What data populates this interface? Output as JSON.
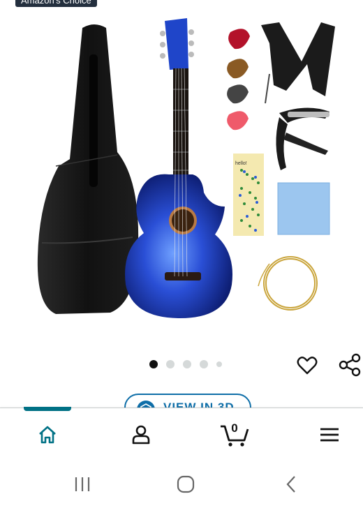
{
  "badge": {
    "label": "Amazon's Choice"
  },
  "product": {
    "image_icon": "guitar-kit-image",
    "image_alt": "Blue acoustic guitar kit with gig bag, picks, strap, capo, fretboard stickers, cloth and strings",
    "fretboard_sticker_text": "hello!"
  },
  "carousel": {
    "count": 5,
    "active_index": 0
  },
  "actions": {
    "wishlist_icon": "heart-icon",
    "share_icon": "share-icon"
  },
  "view_3d": {
    "label": "VIEW IN 3D",
    "icon": "cube-3d-icon"
  },
  "nav": {
    "items": [
      {
        "name": "home",
        "icon": "home-icon",
        "active": true
      },
      {
        "name": "account",
        "icon": "user-icon",
        "active": false
      },
      {
        "name": "cart",
        "icon": "cart-icon",
        "count": "0",
        "active": false
      },
      {
        "name": "menu",
        "icon": "menu-icon",
        "active": false
      }
    ]
  },
  "colors": {
    "accent": "#007185",
    "badge_bg": "#232f3e",
    "view3d": "#0e6ea8",
    "guitar_blue": "#1f45c9"
  }
}
